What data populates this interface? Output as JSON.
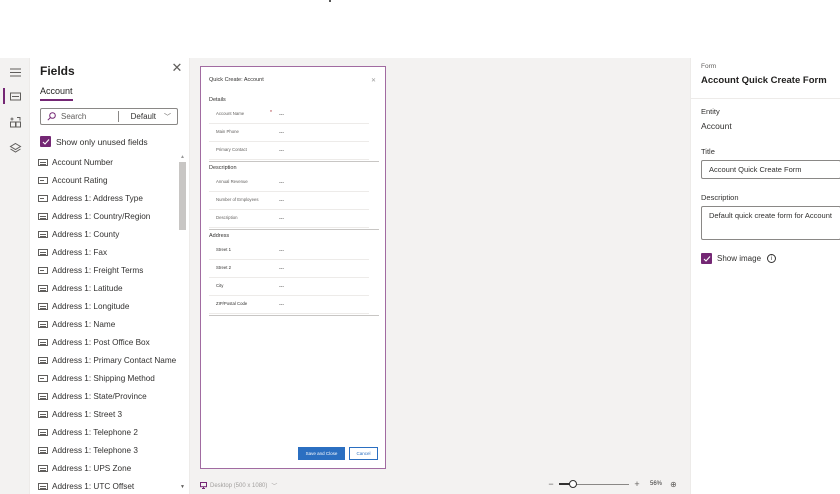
{
  "fields_panel": {
    "title": "Fields",
    "tab": "Account",
    "search_placeholder": "Search",
    "filter_value": "Default",
    "show_unused_label": "Show only unused fields",
    "items": [
      {
        "label": "Account Number",
        "icon": "text-field-icon"
      },
      {
        "label": "Account Rating",
        "icon": "option-set-icon"
      },
      {
        "label": "Address 1: Address Type",
        "icon": "option-set-icon"
      },
      {
        "label": "Address 1: Country/Region",
        "icon": "text-field-icon"
      },
      {
        "label": "Address 1: County",
        "icon": "text-field-icon"
      },
      {
        "label": "Address 1: Fax",
        "icon": "text-field-icon"
      },
      {
        "label": "Address 1: Freight Terms",
        "icon": "option-set-icon"
      },
      {
        "label": "Address 1: Latitude",
        "icon": "text-field-icon"
      },
      {
        "label": "Address 1: Longitude",
        "icon": "text-field-icon"
      },
      {
        "label": "Address 1: Name",
        "icon": "text-field-icon"
      },
      {
        "label": "Address 1: Post Office Box",
        "icon": "text-field-icon"
      },
      {
        "label": "Address 1: Primary Contact Name",
        "icon": "text-field-icon"
      },
      {
        "label": "Address 1: Shipping Method",
        "icon": "option-set-icon"
      },
      {
        "label": "Address 1: State/Province",
        "icon": "text-field-icon"
      },
      {
        "label": "Address 1: Street 3",
        "icon": "text-field-icon"
      },
      {
        "label": "Address 1: Telephone 2",
        "icon": "text-field-icon"
      },
      {
        "label": "Address 1: Telephone 3",
        "icon": "text-field-icon"
      },
      {
        "label": "Address 1: UPS Zone",
        "icon": "text-field-icon"
      },
      {
        "label": "Address 1: UTC Offset",
        "icon": "text-field-icon"
      }
    ]
  },
  "form_preview": {
    "title": "Quick Create: Account",
    "sections": [
      {
        "name": "Details",
        "rows": [
          {
            "label": "Account Name",
            "required": "*",
            "value": "---"
          },
          {
            "label": "Main Phone",
            "required": "",
            "value": "---"
          },
          {
            "label": "Primary Contact",
            "required": "",
            "value": "---"
          }
        ]
      },
      {
        "name": "Description",
        "rows": [
          {
            "label": "Annual Revenue",
            "required": "",
            "value": "---"
          },
          {
            "label": "Number of Employees",
            "required": "",
            "value": "---"
          },
          {
            "label": "Description",
            "required": "",
            "value": "---"
          }
        ]
      },
      {
        "name": "Address",
        "rows": [
          {
            "label": "Street 1",
            "required": "",
            "value": "---"
          },
          {
            "label": "Street 2",
            "required": "",
            "value": "---"
          },
          {
            "label": "City",
            "required": "",
            "value": "---"
          },
          {
            "label": "ZIP/Postal Code",
            "required": "",
            "value": "---"
          }
        ]
      }
    ],
    "save_label": "Save and Close",
    "cancel_label": "Cancel"
  },
  "bottom_bar": {
    "device_label": "Desktop (500 x 1080)",
    "zoom_percent": "56%",
    "zoom_level": 0.56
  },
  "properties": {
    "kind": "Form",
    "name": "Account Quick Create Form",
    "entity_label": "Entity",
    "entity_value": "Account",
    "title_label": "Title",
    "title_value": "Account Quick Create Form",
    "description_label": "Description",
    "description_value": "Default quick create form for Account",
    "show_image_label": "Show image"
  },
  "colors": {
    "accent": "#742774",
    "primary_button": "#2b6fc1"
  }
}
